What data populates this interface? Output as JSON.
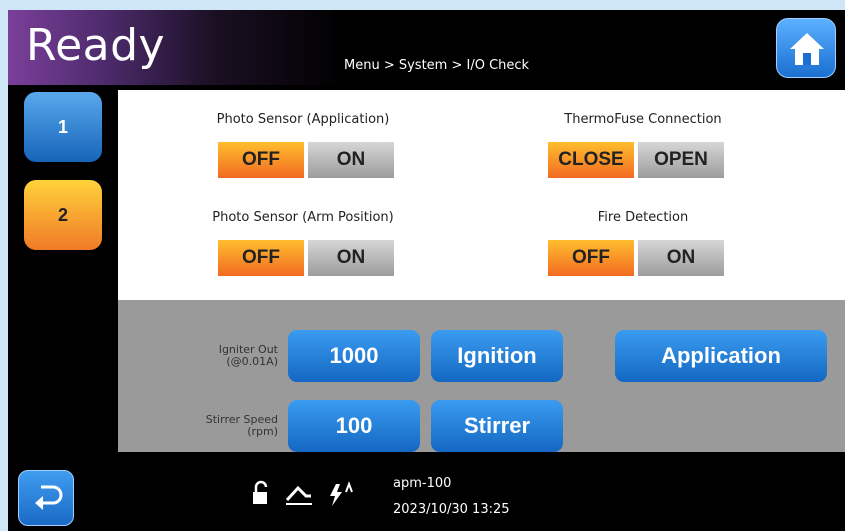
{
  "header": {
    "title": "Ready",
    "breadcrumb": "Menu > System > I/O Check"
  },
  "side_tabs": [
    {
      "label": "1",
      "color": "#1f72c6"
    },
    {
      "label": "2",
      "color": "#f59a2c"
    }
  ],
  "io": {
    "photo_sensor_application": {
      "label": "Photo Sensor (Application)",
      "left": "OFF",
      "right": "ON",
      "active": "OFF"
    },
    "thermofuse_connection": {
      "label": "ThermoFuse Connection",
      "left": "CLOSE",
      "right": "OPEN",
      "active": "CLOSE"
    },
    "photo_sensor_arm": {
      "label": "Photo Sensor (Arm Position)",
      "left": "OFF",
      "right": "ON",
      "active": "OFF"
    },
    "fire_detection": {
      "label": "Fire Detection",
      "left": "OFF",
      "right": "ON",
      "active": "OFF"
    }
  },
  "controls": {
    "igniter_out_label_1": "Igniter Out",
    "igniter_out_label_2": "(@0.01A)",
    "igniter_out_value": "1000",
    "ignition_label": "Ignition",
    "application_label": "Application",
    "stirrer_speed_label_1": "Stirrer Speed",
    "stirrer_speed_label_2": "(rpm)",
    "stirrer_speed_value": "100",
    "stirrer_label": "Stirrer"
  },
  "footer": {
    "model": "apm-100",
    "datetime": "2023/10/30 13:25"
  },
  "colors": {
    "active_orange": "#f26a22",
    "inactive_gray": "#a0a0a0",
    "button_blue": "#1f72c6"
  }
}
